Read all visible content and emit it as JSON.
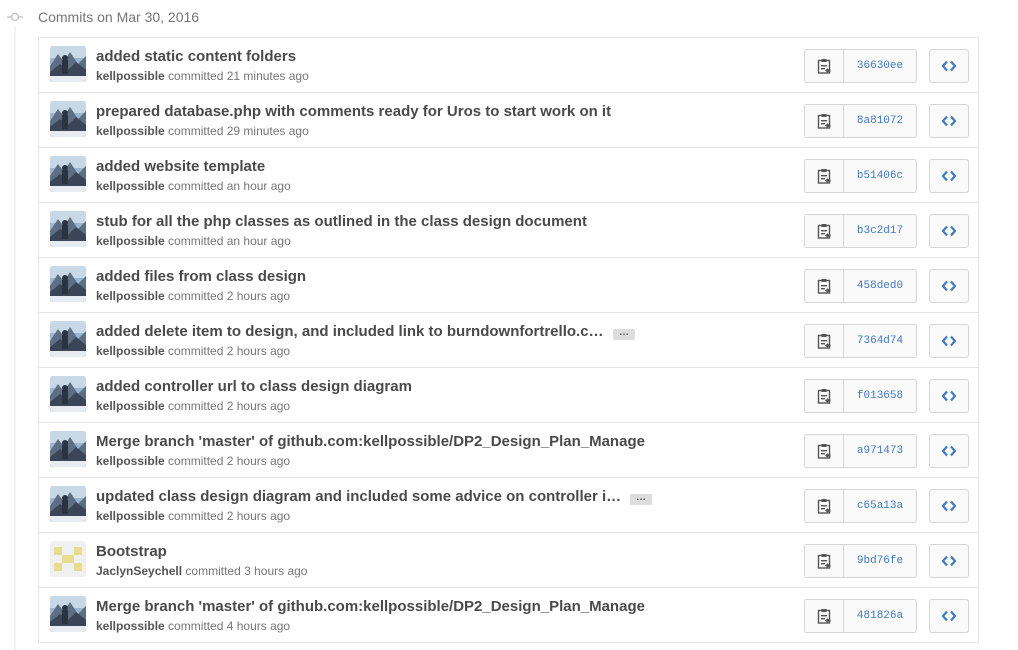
{
  "header": {
    "label": "Commits on Mar 30, 2016"
  },
  "colors": {
    "sha": "#4078c0",
    "title": "#4a4a4a",
    "meta": "#767676"
  },
  "icons": {
    "copy": "clipboard-icon",
    "browse": "code-icon",
    "timeline": "commit-node-icon"
  },
  "commits": [
    {
      "title": "added static content folders",
      "author": "kellpossible",
      "time": "committed 21 minutes ago",
      "sha": "36630ee",
      "truncated": false,
      "avatar": "landscape"
    },
    {
      "title": "prepared database.php with comments ready for Uros to start work on it",
      "author": "kellpossible",
      "time": "committed 29 minutes ago",
      "sha": "8a81072",
      "truncated": false,
      "avatar": "landscape"
    },
    {
      "title": "added website template",
      "author": "kellpossible",
      "time": "committed an hour ago",
      "sha": "b51406c",
      "truncated": false,
      "avatar": "landscape"
    },
    {
      "title": "stub for all the php classes as outlined in the class design document",
      "author": "kellpossible",
      "time": "committed an hour ago",
      "sha": "b3c2d17",
      "truncated": false,
      "avatar": "landscape"
    },
    {
      "title": "added files from class design",
      "author": "kellpossible",
      "time": "committed 2 hours ago",
      "sha": "458ded0",
      "truncated": false,
      "avatar": "landscape"
    },
    {
      "title": "added delete item to design, and included link to burndownfortrello.c…",
      "author": "kellpossible",
      "time": "committed 2 hours ago",
      "sha": "7364d74",
      "truncated": true,
      "avatar": "landscape"
    },
    {
      "title": "added controller url to class design diagram",
      "author": "kellpossible",
      "time": "committed 2 hours ago",
      "sha": "f013658",
      "truncated": false,
      "avatar": "landscape"
    },
    {
      "title": "Merge branch 'master' of github.com:kellpossible/DP2_Design_Plan_Manage",
      "author": "kellpossible",
      "time": "committed 2 hours ago",
      "sha": "a971473",
      "truncated": false,
      "avatar": "landscape"
    },
    {
      "title": "updated class design diagram and included some advice on controller i…",
      "author": "kellpossible",
      "time": "committed 2 hours ago",
      "sha": "c65a13a",
      "truncated": true,
      "avatar": "landscape"
    },
    {
      "title": "Bootstrap",
      "author": "JaclynSeychell",
      "time": "committed 3 hours ago",
      "sha": "9bd76fe",
      "truncated": false,
      "avatar": "identicon"
    },
    {
      "title": "Merge branch 'master' of github.com:kellpossible/DP2_Design_Plan_Manage",
      "author": "kellpossible",
      "time": "committed 4 hours ago",
      "sha": "481826a",
      "truncated": false,
      "avatar": "landscape"
    }
  ]
}
